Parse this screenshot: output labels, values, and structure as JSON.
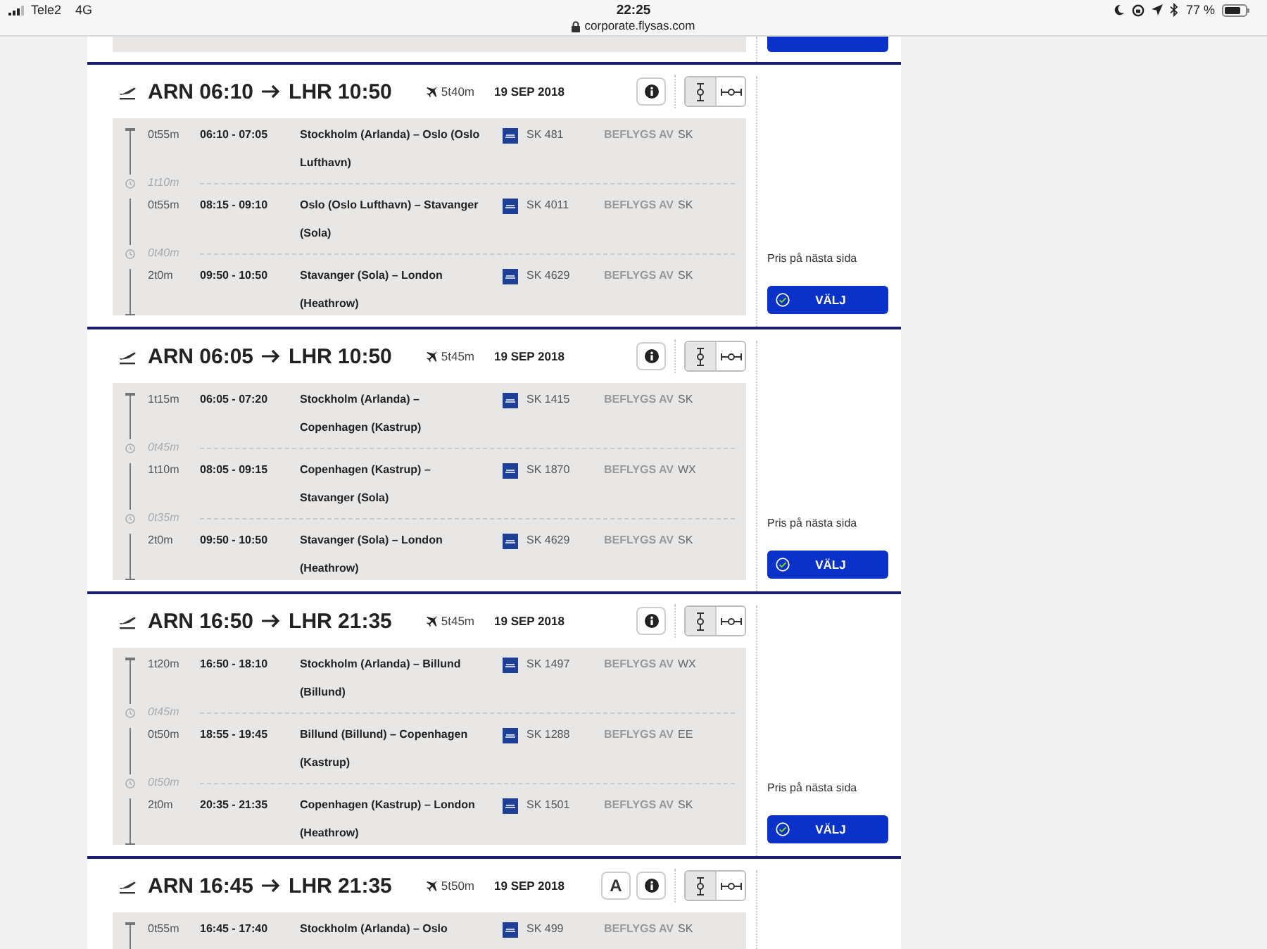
{
  "status_bar": {
    "carrier": "Tele2",
    "network": "4G",
    "time": "22:25",
    "url": "corporate.flysas.com",
    "battery": "77 %"
  },
  "cards": [
    {
      "kind": "partial"
    },
    {
      "kind": "flight",
      "from": "ARN 06:10",
      "to": "LHR 10:50",
      "duration": "5t40m",
      "date": "19 SEP 2018",
      "view_toggle": [
        {
          "kind": "vertical",
          "selected": true
        },
        {
          "kind": "horizontal",
          "selected": false
        }
      ],
      "segments": [
        {
          "duration": "0t55m",
          "times": "06:10 - 07:05",
          "route": "Stockholm (Arlanda) – Oslo (Oslo Lufthavn)",
          "flight": "SK 481",
          "operator_label": "BEFLYGS AV",
          "operator": "SK"
        },
        {
          "layover_before": "1t10m",
          "duration": "0t55m",
          "times": "08:15 - 09:10",
          "route": "Oslo (Oslo Lufthavn) – Stavanger (Sola)",
          "flight": "SK 4011",
          "operator_label": "BEFLYGS AV",
          "operator": "SK"
        },
        {
          "layover_before": "0t40m",
          "duration": "2t0m",
          "times": "09:50 - 10:50",
          "route": "Stavanger (Sola) – London (Heathrow)",
          "flight": "SK 4629",
          "operator_label": "BEFLYGS AV",
          "operator": "SK"
        }
      ],
      "price_note": "Pris på nästa sida",
      "button": "VÄLJ"
    },
    {
      "kind": "flight",
      "from": "ARN 06:05",
      "to": "LHR 10:50",
      "duration": "5t45m",
      "date": "19 SEP 2018",
      "view_toggle": [
        {
          "kind": "vertical",
          "selected": true
        },
        {
          "kind": "horizontal",
          "selected": false
        }
      ],
      "segments": [
        {
          "duration": "1t15m",
          "times": "06:05 - 07:20",
          "route": "Stockholm (Arlanda) – Copenhagen (Kastrup)",
          "flight": "SK 1415",
          "operator_label": "BEFLYGS AV",
          "operator": "SK"
        },
        {
          "layover_before": "0t45m",
          "duration": "1t10m",
          "times": "08:05 - 09:15",
          "route": "Copenhagen (Kastrup) – Stavanger (Sola)",
          "flight": "SK 1870",
          "operator_label": "BEFLYGS AV",
          "operator": "WX"
        },
        {
          "layover_before": "0t35m",
          "duration": "2t0m",
          "times": "09:50 - 10:50",
          "route": "Stavanger (Sola) – London (Heathrow)",
          "flight": "SK 4629",
          "operator_label": "BEFLYGS AV",
          "operator": "SK"
        }
      ],
      "price_note": "Pris på nästa sida",
      "button": "VÄLJ"
    },
    {
      "kind": "flight",
      "from": "ARN 16:50",
      "to": "LHR 21:35",
      "duration": "5t45m",
      "date": "19 SEP 2018",
      "view_toggle": [
        {
          "kind": "vertical",
          "selected": true
        },
        {
          "kind": "horizontal",
          "selected": false
        }
      ],
      "segments": [
        {
          "duration": "1t20m",
          "times": "16:50 - 18:10",
          "route": "Stockholm (Arlanda) – Billund (Billund)",
          "flight": "SK 1497",
          "operator_label": "BEFLYGS AV",
          "operator": "WX"
        },
        {
          "layover_before": "0t45m",
          "duration": "0t50m",
          "times": "18:55 - 19:45",
          "route": "Billund (Billund) – Copenhagen (Kastrup)",
          "flight": "SK 1288",
          "operator_label": "BEFLYGS AV",
          "operator": "EE"
        },
        {
          "layover_before": "0t50m",
          "duration": "2t0m",
          "times": "20:35 - 21:35",
          "route": "Copenhagen (Kastrup) – London (Heathrow)",
          "flight": "SK 1501",
          "operator_label": "BEFLYGS AV",
          "operator": "SK"
        }
      ],
      "price_note": "Pris på nästa sida",
      "button": "VÄLJ"
    },
    {
      "kind": "flight",
      "from": "ARN 16:45",
      "to": "LHR 21:35",
      "duration": "5t50m",
      "date": "19 SEP 2018",
      "badge": "A",
      "view_toggle": [
        {
          "kind": "vertical",
          "selected": true
        },
        {
          "kind": "horizontal",
          "selected": false
        }
      ],
      "segments": [
        {
          "duration": "0t55m",
          "times": "16:45 - 17:40",
          "route": "Stockholm (Arlanda) – Oslo",
          "flight": "SK 499",
          "operator_label": "BEFLYGS AV",
          "operator": "SK"
        }
      ]
    }
  ]
}
